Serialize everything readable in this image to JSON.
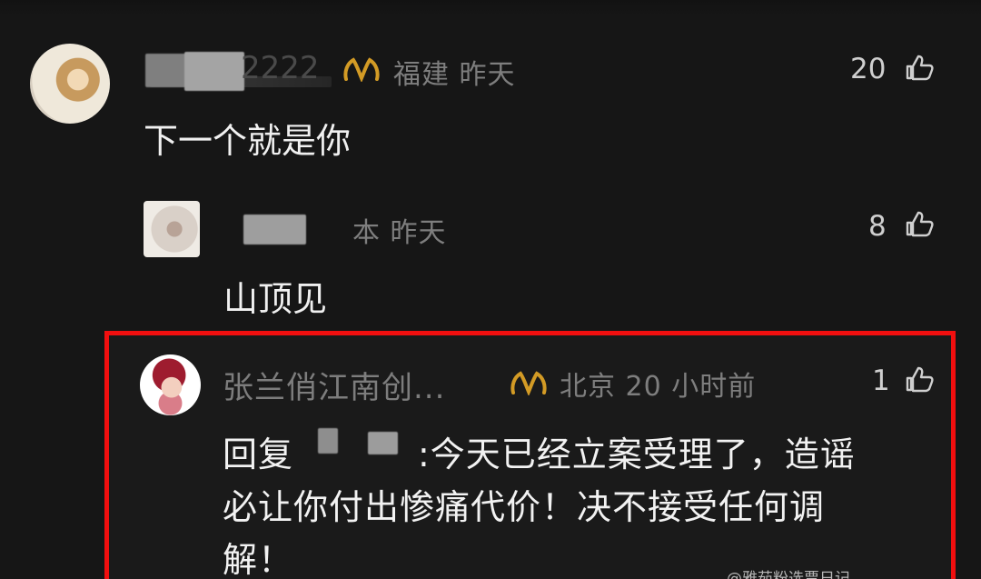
{
  "comments": [
    {
      "username_partial": "2222",
      "location": "福建",
      "time": "昨天",
      "text": "下一个就是你",
      "likes": "20"
    },
    {
      "location": "本",
      "time": "昨天",
      "text": "山顶见",
      "likes": "8"
    },
    {
      "username": "张兰俏江南创...",
      "location": "北京",
      "time": "20 小时前",
      "reply_prefix": "回复",
      "reply_colon": ":今天已经立案受理了，造谣",
      "reply_line_2": "必让你付出惨痛代价！决不接受任何调",
      "reply_line_3": "解！",
      "likes": "1"
    }
  ],
  "watermark": "@雅茹粉选票日记",
  "icons": {
    "like": "thumbs-up-icon",
    "badge": "gold-badge-icon"
  },
  "colors": {
    "background": "#161616",
    "highlight": "#f10f0f",
    "badge": "#d39b25"
  }
}
